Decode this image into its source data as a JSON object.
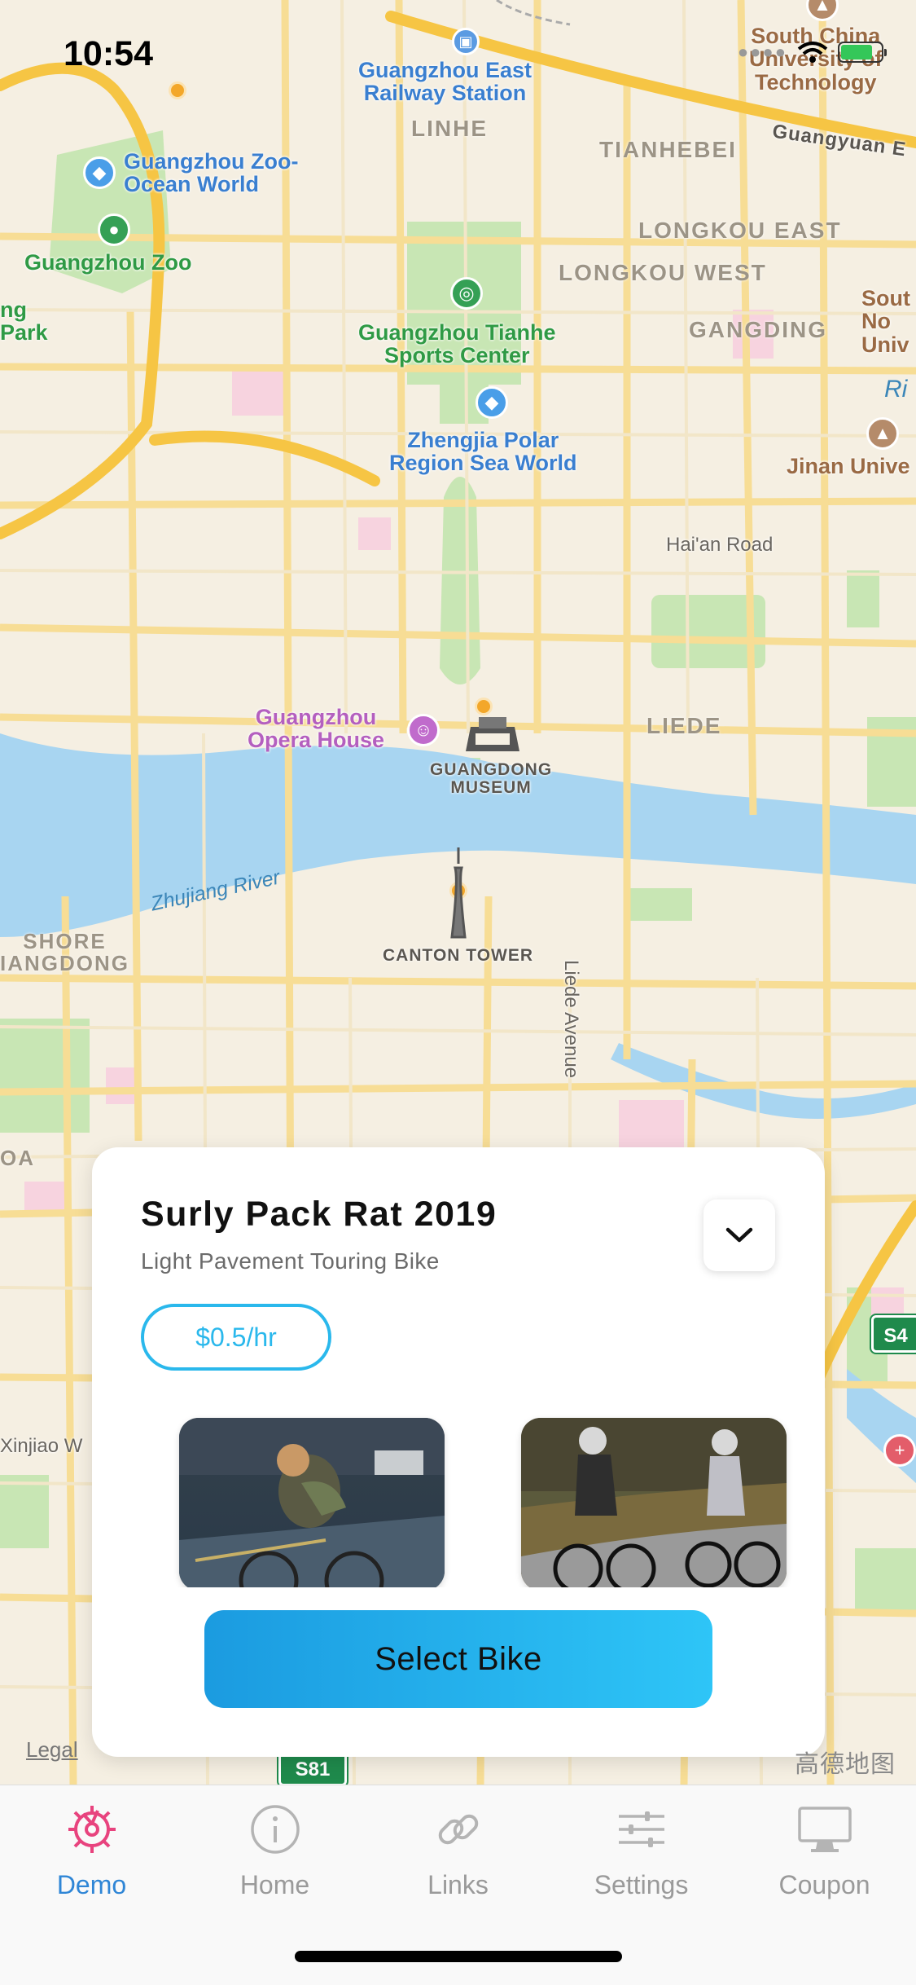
{
  "status_bar": {
    "time": "10:54"
  },
  "map": {
    "labels": {
      "railway_station": "Guangzhou East\nRailway Station",
      "linhe": "LINHE",
      "tianhebei": "TIANHEBEI",
      "guangyuan": "Guangyuan E",
      "south_china_univ": "South China\nUniversity of\nTechnology",
      "zoo_ocean": "Guangzhou Zoo-\nOcean World",
      "zoo": "Guangzhou Zoo",
      "park": "ng\nPark",
      "longkou_east": "LONGKOU EAST",
      "longkou_west": "LONGKOU WEST",
      "gangding": "GANGDING",
      "south_right": "Sout\nNo\nUniv",
      "sports_center": "Guangzhou Tianhe\nSports Center",
      "polar_world": "Zhengjia Polar\nRegion Sea World",
      "ri": "Ri",
      "jinan": "Jinan Unive",
      "haian": "Hai'an Road",
      "opera": "Guangzhou\nOpera House",
      "museum": "GUANGDONG\nMUSEUM",
      "liede": "LIEDE",
      "zhujiang": "Zhujiang River",
      "shore": "SHORE\nIANGDONG",
      "canton_tower": "CANTON TOWER",
      "liede_avenue": "Liede Avenue",
      "oa": "OA",
      "xinjiao": "Xinjiao W",
      "s4": "S4",
      "s81": "S81"
    },
    "legal": "Legal",
    "brand": "高德地图"
  },
  "card": {
    "bike_name": "Surly Pack Rat 2019",
    "bike_type": "Light Pavement Touring Bike",
    "price": "$0.5/hr",
    "select_label": "Select Bike"
  },
  "tabbar": {
    "tabs": [
      {
        "label": "Demo",
        "icon": "gear-icon",
        "active": true
      },
      {
        "label": "Home",
        "icon": "info-icon",
        "active": false
      },
      {
        "label": "Links",
        "icon": "link-icon",
        "active": false
      },
      {
        "label": "Settings",
        "icon": "sliders-icon",
        "active": false
      },
      {
        "label": "Coupon",
        "icon": "monitor-icon",
        "active": false
      }
    ]
  },
  "colors": {
    "accent": "#2ab8ec",
    "tab_active": "#2f86d6",
    "gear_active": "#e8437e"
  }
}
